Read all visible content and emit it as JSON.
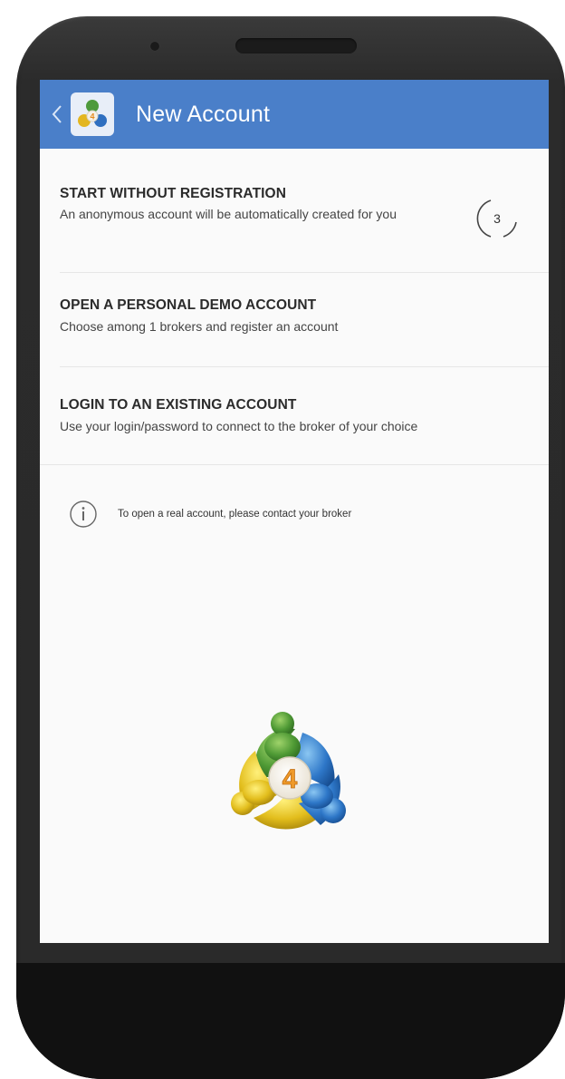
{
  "app_bar": {
    "title": "New Account",
    "color": "#4a7fc9"
  },
  "options": [
    {
      "title": "START WITHOUT REGISTRATION",
      "subtitle": "An anonymous account will be automatically created for you"
    },
    {
      "title": "OPEN A PERSONAL DEMO ACCOUNT",
      "subtitle": "Choose among 1 brokers and register an account"
    },
    {
      "title": "LOGIN TO AN EXISTING ACCOUNT",
      "subtitle": "Use your login/password to connect to the broker of your choice"
    }
  ],
  "countdown": {
    "value": "3"
  },
  "info": {
    "text": "To open a real account, please contact your broker"
  },
  "logo": {
    "number": "4"
  },
  "icons": {
    "back": "chevron-left-icon",
    "app": "metatrader-icon",
    "info": "info-circle-icon",
    "logo": "metatrader-4-logo"
  }
}
